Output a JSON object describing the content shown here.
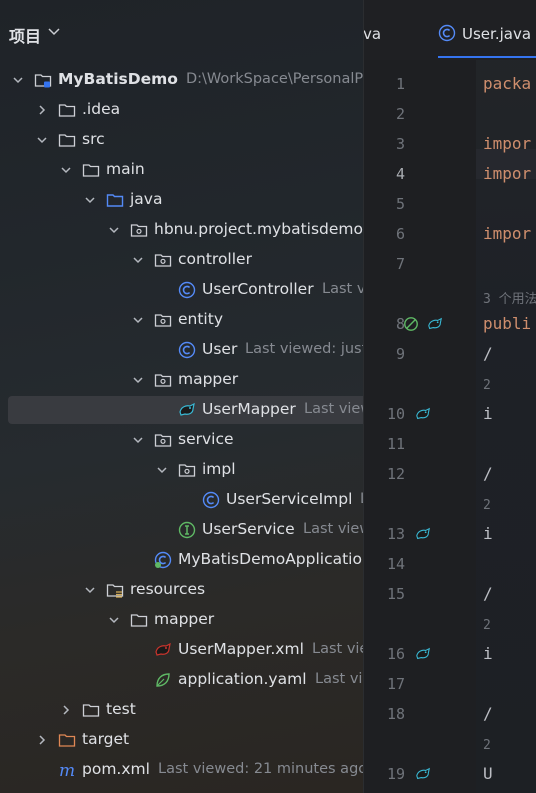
{
  "project_panel": {
    "title": "项目",
    "tree": [
      {
        "label": "MyBatisDemo",
        "hint": "D:\\WorkSpace\\PersonalProject",
        "bold": true,
        "icon": "module-folder-icon",
        "expanded": true
      },
      {
        "label": ".idea",
        "icon": "folder-icon",
        "expanded": false
      },
      {
        "label": "src",
        "icon": "folder-icon",
        "expanded": true
      },
      {
        "label": "main",
        "icon": "folder-icon",
        "expanded": true
      },
      {
        "label": "java",
        "icon": "source-folder-icon",
        "expanded": true
      },
      {
        "label": "hbnu.project.mybatisdemo",
        "icon": "package-icon",
        "expanded": true
      },
      {
        "label": "controller",
        "icon": "package-icon",
        "expanded": true
      },
      {
        "label": "UserController",
        "hint": "Last viewed",
        "icon": "class-icon"
      },
      {
        "label": "entity",
        "icon": "package-icon",
        "expanded": true
      },
      {
        "label": "User",
        "hint": "Last viewed: just now",
        "icon": "class-icon"
      },
      {
        "label": "mapper",
        "icon": "package-icon",
        "expanded": true
      },
      {
        "label": "UserMapper",
        "hint": "Last viewed",
        "icon": "mybatis-mapper-icon",
        "selected": true
      },
      {
        "label": "service",
        "icon": "package-icon",
        "expanded": true
      },
      {
        "label": "impl",
        "icon": "package-icon",
        "expanded": true
      },
      {
        "label": "UserServiceImpl",
        "hint": "Last viewed",
        "icon": "class-icon"
      },
      {
        "label": "UserService",
        "hint": "Last viewed",
        "icon": "interface-icon"
      },
      {
        "label": "MyBatisDemoApplication",
        "hint": "Last viewed",
        "icon": "spring-boot-class-icon"
      },
      {
        "label": "resources",
        "icon": "resources-folder-icon",
        "expanded": true
      },
      {
        "label": "mapper",
        "icon": "folder-icon",
        "expanded": true
      },
      {
        "label": "UserMapper.xml",
        "hint": "Last viewed",
        "icon": "mybatis-xml-icon"
      },
      {
        "label": "application.yaml",
        "hint": "Last viewed",
        "icon": "spring-yaml-icon"
      },
      {
        "label": "test",
        "icon": "folder-icon",
        "expanded": false
      },
      {
        "label": "target",
        "icon": "excluded-folder-icon",
        "expanded": false
      },
      {
        "label": "pom.xml",
        "hint": "Last viewed: 21 minutes ago",
        "icon": "maven-icon"
      }
    ]
  },
  "editor": {
    "tabs": [
      {
        "label": "va",
        "icon": ""
      },
      {
        "label": "User.java",
        "icon": "class-icon",
        "active": true
      }
    ],
    "lines": [
      {
        "n": "1",
        "code": "packa",
        "style": "kw"
      },
      {
        "n": "2",
        "code": ""
      },
      {
        "n": "3",
        "code": "impor",
        "style": "kw"
      },
      {
        "n": "4",
        "code": "impor",
        "style": "kw",
        "current": true
      },
      {
        "n": "5",
        "code": ""
      },
      {
        "n": "6",
        "code": "impor",
        "style": "kw"
      },
      {
        "n": "7",
        "code": ""
      },
      {
        "n": "",
        "code": "3 个用法",
        "style": "usage"
      },
      {
        "n": "8",
        "code": "publi",
        "style": "kw",
        "gutter": [
          "no-entry-icon",
          "mybatis-mapper-icon"
        ]
      },
      {
        "n": "9",
        "code": "  /",
        "style": "comment"
      },
      {
        "n": "",
        "code": "  2",
        "style": "usage"
      },
      {
        "n": "10",
        "code": "  i",
        "style": "plain",
        "gutter": [
          "mybatis-mapper-icon"
        ]
      },
      {
        "n": "11",
        "code": ""
      },
      {
        "n": "12",
        "code": "  /",
        "style": "comment"
      },
      {
        "n": "",
        "code": "  2",
        "style": "usage"
      },
      {
        "n": "13",
        "code": "  i",
        "style": "plain",
        "gutter": [
          "mybatis-mapper-icon"
        ]
      },
      {
        "n": "14",
        "code": ""
      },
      {
        "n": "15",
        "code": "  /",
        "style": "comment"
      },
      {
        "n": "",
        "code": "  2",
        "style": "usage"
      },
      {
        "n": "16",
        "code": "  i",
        "style": "plain",
        "gutter": [
          "mybatis-mapper-icon"
        ]
      },
      {
        "n": "17",
        "code": ""
      },
      {
        "n": "18",
        "code": "  /",
        "style": "comment"
      },
      {
        "n": "",
        "code": "  2",
        "style": "usage"
      },
      {
        "n": "19",
        "code": "  U",
        "style": "plain",
        "gutter": [
          "mybatis-mapper-icon"
        ]
      }
    ]
  },
  "colors": {
    "accent": "#3574f0",
    "keyword": "#cf8e6d",
    "text": "#dfe1e5",
    "hint": "#868a91",
    "selection": "#393b40"
  }
}
